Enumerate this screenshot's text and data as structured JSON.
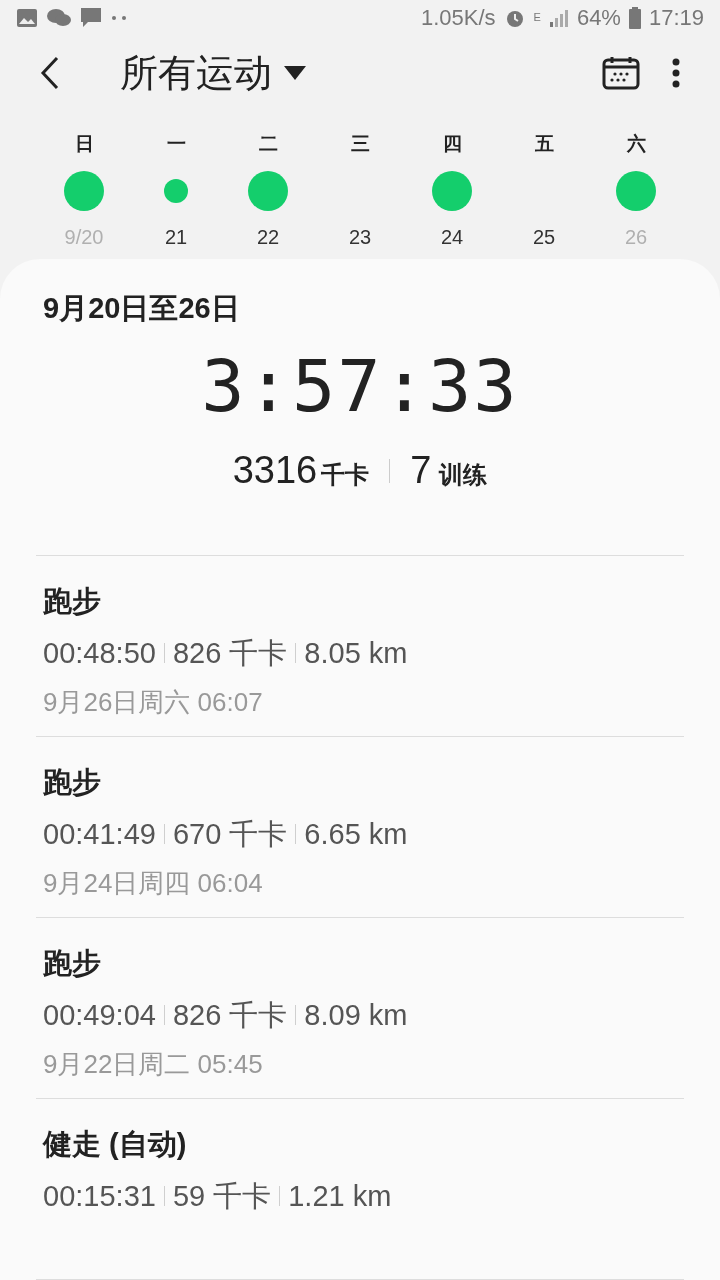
{
  "status_bar": {
    "speed": "1.05K/s",
    "network": "E",
    "battery": "64%",
    "time": "17:19"
  },
  "toolbar": {
    "title": "所有运动"
  },
  "week": [
    {
      "weekday": "日",
      "date": "9/20",
      "kind": "large",
      "dimmed": true
    },
    {
      "weekday": "一",
      "date": "21",
      "kind": "small",
      "dimmed": false
    },
    {
      "weekday": "二",
      "date": "22",
      "kind": "large",
      "dimmed": false
    },
    {
      "weekday": "三",
      "date": "23",
      "kind": "empty",
      "dimmed": false
    },
    {
      "weekday": "四",
      "date": "24",
      "kind": "large",
      "dimmed": false
    },
    {
      "weekday": "五",
      "date": "25",
      "kind": "empty",
      "dimmed": false
    },
    {
      "weekday": "六",
      "date": "26",
      "kind": "large",
      "dimmed": true
    }
  ],
  "summary": {
    "range": "9月20日至26日",
    "duration": "3:57:33",
    "calories": "3316",
    "calories_unit": "千卡",
    "workouts": "7",
    "workouts_unit": "训练"
  },
  "workouts": [
    {
      "name": "跑步",
      "duration": "00:48:50",
      "calories": "826 千卡",
      "distance": "8.05 km",
      "date": "9月26日周六 06:07"
    },
    {
      "name": "跑步",
      "duration": "00:41:49",
      "calories": "670 千卡",
      "distance": "6.65 km",
      "date": "9月24日周四 06:04"
    },
    {
      "name": "跑步",
      "duration": "00:49:04",
      "calories": "826 千卡",
      "distance": "8.09 km",
      "date": "9月22日周二 05:45"
    },
    {
      "name": "健走 (自动)",
      "duration": "00:15:31",
      "calories": "59 千卡",
      "distance": "1.21 km"
    }
  ]
}
